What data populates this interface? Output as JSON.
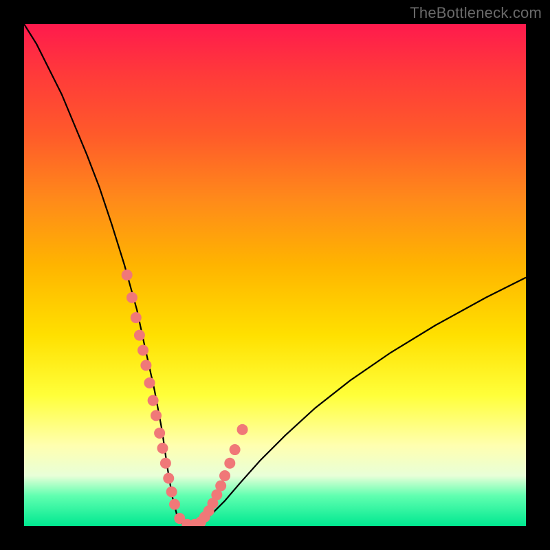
{
  "watermark": "TheBottleneck.com",
  "chart_data": {
    "type": "line",
    "title": "",
    "xlabel": "",
    "ylabel": "",
    "xlim": [
      0,
      100
    ],
    "ylim": [
      0,
      100
    ],
    "series": [
      {
        "name": "bottleneck-curve",
        "x": [
          0,
          2.5,
          5,
          7.5,
          10,
          12.5,
          15,
          17.5,
          20,
          22.5,
          24,
          26,
          27.5,
          28.5,
          29.5,
          30.5,
          31.5,
          33,
          35,
          37,
          40,
          43,
          47,
          52,
          58,
          65,
          73,
          82,
          92,
          100
        ],
        "values": [
          100,
          96,
          91,
          86,
          80,
          74,
          67.5,
          60,
          52,
          43,
          36,
          27,
          19,
          12,
          6,
          2,
          0.5,
          0,
          0.5,
          2,
          5,
          8.5,
          13,
          18,
          23.5,
          29,
          34.5,
          40,
          45.5,
          49.5
        ]
      }
    ],
    "markers": {
      "name": "highlight-dots",
      "x": [
        20.5,
        21.5,
        22.3,
        23.0,
        23.7,
        24.3,
        25.0,
        25.7,
        26.3,
        27.0,
        27.6,
        28.2,
        28.8,
        29.4,
        30.0,
        31.0,
        32.5,
        34.0,
        35.2,
        36.0,
        36.8,
        37.6,
        38.4,
        39.2,
        40.0,
        41.0,
        42.0,
        43.5
      ],
      "values": [
        50,
        45.5,
        41.5,
        38,
        35,
        32,
        28.5,
        25,
        22,
        18.5,
        15.5,
        12.5,
        9.5,
        6.8,
        4.3,
        1.5,
        0.3,
        0.3,
        0.8,
        1.8,
        3.0,
        4.5,
        6.2,
        8.0,
        10.0,
        12.5,
        15.2,
        19.2
      ]
    },
    "marker_color": "#f07878",
    "curve_color": "#000000"
  }
}
